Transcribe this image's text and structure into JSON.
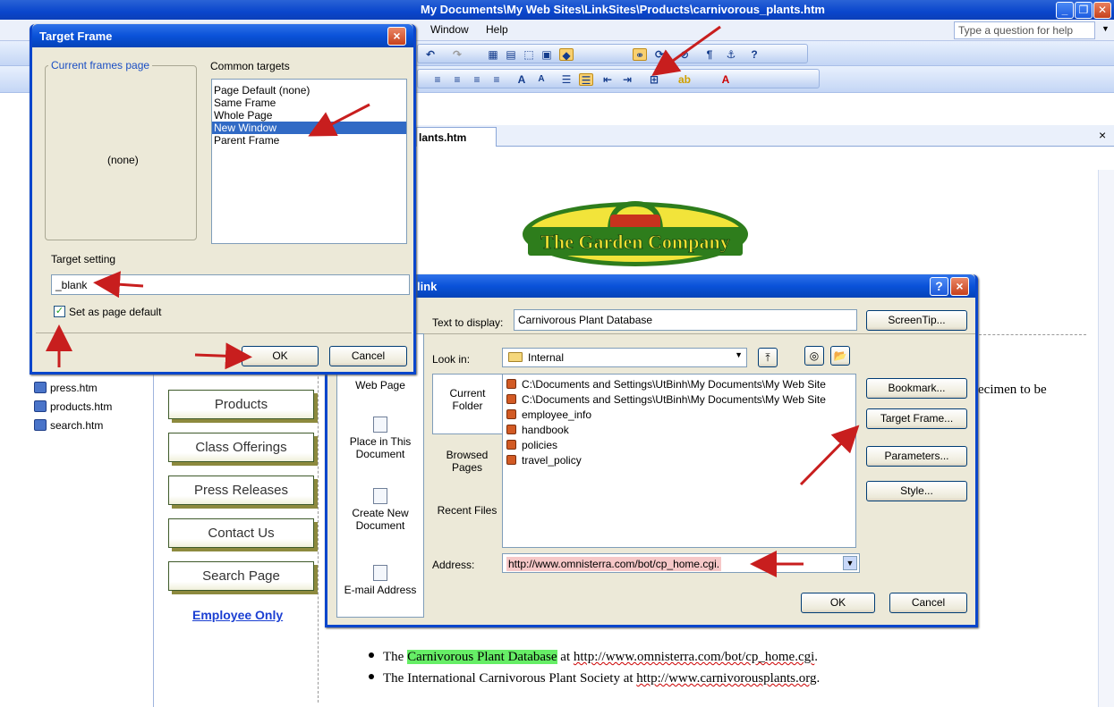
{
  "main_window": {
    "title": "My Documents\\My Web Sites\\LinkSites\\Products\\carnivorous_plants.htm",
    "menu": [
      "Window",
      "Help"
    ],
    "help_placeholder": "Type a question for help",
    "tab_label": "lants.htm",
    "tab_close": "×"
  },
  "left_panel": {
    "files": [
      "press.htm",
      "products.htm",
      "search.htm"
    ]
  },
  "page": {
    "logo_text": "The Garden Company",
    "nav_buttons": [
      "Products",
      "Class Offerings",
      "Press Releases",
      "Contact Us",
      "Search Page"
    ],
    "employee_link": "Employee Only",
    "partial_text": "ecimen to be",
    "bullets": [
      {
        "prefix": "The ",
        "highlight": "Carnivorous Plant Database",
        "suffix": " at ",
        "url": "http://www.omnisterra.com/bot/cp_home.cgi",
        "end": "."
      },
      {
        "prefix": "The International Carnivorous Plant Society at ",
        "highlight": "",
        "suffix": "",
        "url": "http://www.carnivorousplants.org",
        "end": "."
      }
    ]
  },
  "target_frame_dialog": {
    "title": "Target Frame",
    "close": "×",
    "current_frames_label": "Current frames page",
    "current_frames_value": "(none)",
    "common_targets_label": "Common targets",
    "targets": [
      "Page Default (none)",
      "Same Frame",
      "Whole Page",
      "New Window",
      "Parent Frame"
    ],
    "selected_target": "New Window",
    "target_setting_label": "Target setting",
    "target_setting_value": "_blank",
    "set_default_label": "Set as page default",
    "set_default_checked": true,
    "ok": "OK",
    "cancel": "Cancel"
  },
  "hyperlink_dialog": {
    "title": "link",
    "help": "?",
    "close": "×",
    "text_to_display_label": "Text to display:",
    "text_to_display_value": "Carnivorous Plant Database",
    "screentip": "ScreenTip...",
    "look_in_label": "Look in:",
    "look_in_value": "Internal",
    "link_to": [
      "Web Page",
      "Place in This Document",
      "Create New Document",
      "E-mail Address"
    ],
    "tabs": [
      "Current Folder",
      "Browsed Pages",
      "Recent Files"
    ],
    "files": [
      "C:\\Documents and Settings\\UtBinh\\My Documents\\My Web Site",
      "C:\\Documents and Settings\\UtBinh\\My Documents\\My Web Site",
      "employee_info",
      "handbook",
      "policies",
      "travel_policy"
    ],
    "right_buttons": [
      "Bookmark...",
      "Target Frame...",
      "Parameters...",
      "Style..."
    ],
    "address_label": "Address:",
    "address_value": "http://www.omnisterra.com/bot/cp_home.cgi.",
    "ok": "OK",
    "cancel": "Cancel"
  },
  "colors": {
    "title_blue": "#0a46cc",
    "dialog_bg": "#ece9d8",
    "selection": "#316ac5",
    "annotation_red": "#c81e1e",
    "highlight_green": "#66ee66",
    "address_pink": "#f6c8c8"
  }
}
